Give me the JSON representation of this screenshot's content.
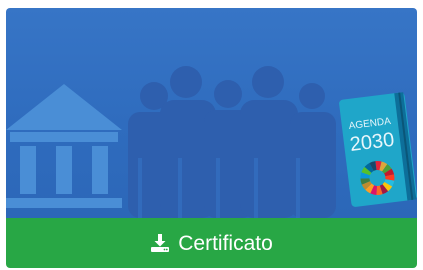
{
  "card": {
    "illustration": {
      "notebook_text": [
        "AGENDA",
        "2030"
      ],
      "colors": {
        "background": "#3070c0",
        "building": "#4a8ed6",
        "people": "#2e5fae",
        "notebook_cover": "#1fa6c9",
        "notebook_spine": "#0d6f9a",
        "notebook_text": "#e8f6fb"
      },
      "sdg_wheel_colors": [
        "#e5243b",
        "#dda63a",
        "#4c9f38",
        "#c5192d",
        "#ff3a21",
        "#26bde2",
        "#fcc30b",
        "#a21942",
        "#fd6925",
        "#dd1367",
        "#fd9d24",
        "#bf8b2e",
        "#3f7e44",
        "#0a97d9",
        "#56c02b",
        "#00689d",
        "#19486a"
      ]
    },
    "download_button": {
      "label": "Certificato",
      "icon": "download-icon",
      "background": "#28a745",
      "text_color": "#ffffff"
    }
  }
}
